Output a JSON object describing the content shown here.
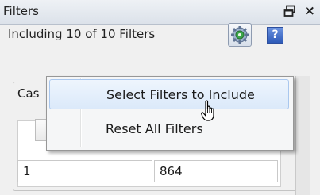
{
  "window": {
    "title": "Filters",
    "float_icon": "float-window-icon",
    "close_label": "×"
  },
  "toolbar": {
    "including_text": "Including 10 of 10 Filters",
    "gear_icon": "gear-icon",
    "help_label": "?"
  },
  "group": {
    "label_partial": "Cas"
  },
  "grid": {
    "row1": {
      "col1": "1",
      "col2": "864"
    }
  },
  "menu": {
    "items": [
      {
        "label": "Select Filters to Include",
        "highlighted": true
      },
      {
        "label": "Reset All Filters",
        "highlighted": false
      }
    ]
  }
}
